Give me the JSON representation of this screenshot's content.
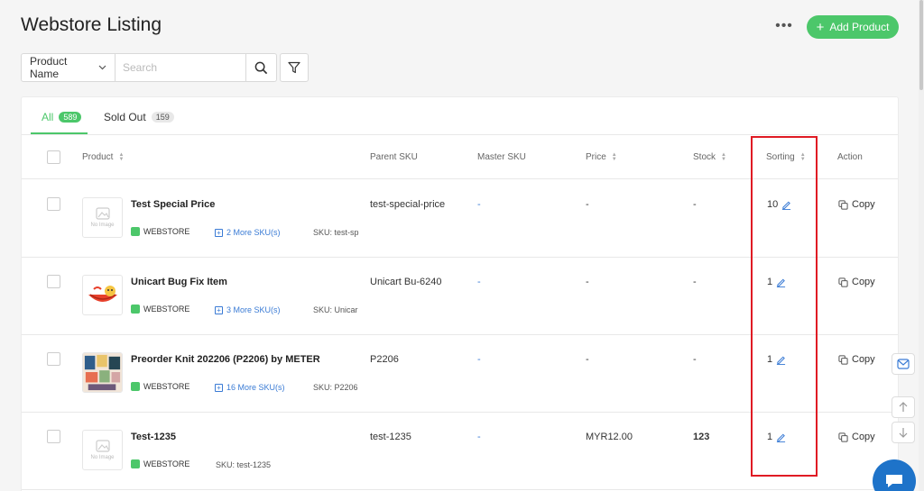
{
  "header": {
    "title": "Webstore Listing",
    "more_label": "•••",
    "add_label": "Add Product"
  },
  "search": {
    "field_label": "Product Name",
    "placeholder": "Search"
  },
  "tabs": [
    {
      "label": "All",
      "count": "589"
    },
    {
      "label": "Sold Out",
      "count": "159"
    }
  ],
  "columns": {
    "product": "Product",
    "parent_sku": "Parent SKU",
    "master_sku": "Master SKU",
    "price": "Price",
    "stock": "Stock",
    "sorting": "Sorting",
    "action": "Action"
  },
  "rows": [
    {
      "name": "Test Special Price",
      "store": "WEBSTORE",
      "more_sku": "2 More SKU(s)",
      "sku": "SKU: test-sp",
      "parent_sku": "test-special-price",
      "master_sku": "-",
      "price": "-",
      "stock": "-",
      "sorting": "10",
      "action": "Copy",
      "image": "No Image"
    },
    {
      "name": "Unicart Bug Fix Item",
      "store": "WEBSTORE",
      "more_sku": "3 More SKU(s)",
      "sku": "SKU: Unicar",
      "parent_sku": "Unicart Bu-6240",
      "master_sku": "-",
      "price": "-",
      "stock": "-",
      "sorting": "1",
      "action": "Copy",
      "image": ""
    },
    {
      "name": "Preorder Knit 202206 (P2206) by METER",
      "store": "WEBSTORE",
      "more_sku": "16 More SKU(s)",
      "sku": "SKU: P2206",
      "parent_sku": "P2206",
      "master_sku": "-",
      "price": "-",
      "stock": "-",
      "sorting": "1",
      "action": "Copy",
      "image": ""
    },
    {
      "name": "Test-1235",
      "store": "WEBSTORE",
      "more_sku": "",
      "sku": "SKU: test-1235",
      "parent_sku": "test-1235",
      "master_sku": "-",
      "price": "MYR12.00",
      "stock": "123",
      "sorting": "1",
      "action": "Copy",
      "image": "No Image"
    }
  ],
  "colors": {
    "accent": "#4cc76a",
    "link": "#3a7bd5",
    "highlight": "#e01b24"
  }
}
